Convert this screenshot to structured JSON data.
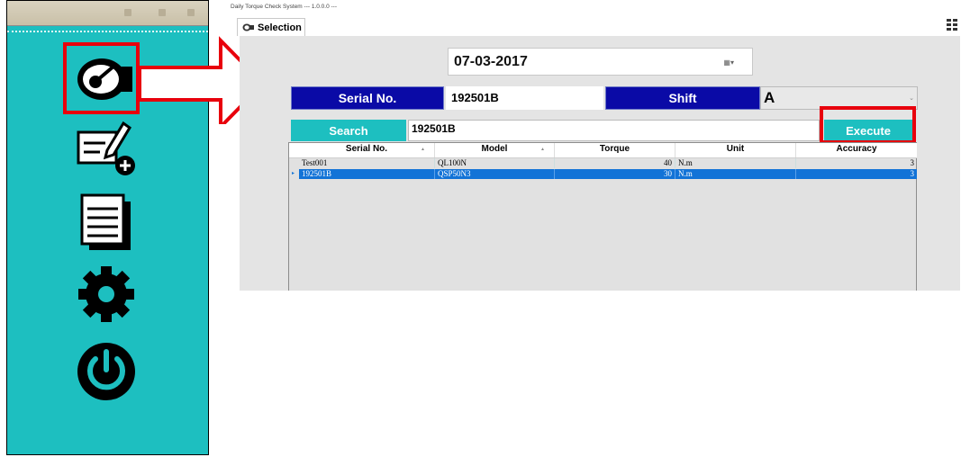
{
  "window": {
    "title": "Daily Torque Check System  ---  1.0.0.0  ---"
  },
  "tab": {
    "label": "Selection"
  },
  "sidebar": {
    "items": [
      {
        "icon": "torque-wrench-icon"
      },
      {
        "icon": "new-document-icon"
      },
      {
        "icon": "list-icon"
      },
      {
        "icon": "settings-icon"
      },
      {
        "icon": "power-icon"
      }
    ]
  },
  "form": {
    "date": "07-03-2017",
    "serial_label": "Serial No.",
    "serial_value": "192501B",
    "shift_label": "Shift",
    "shift_value": "A",
    "search_label": "Search",
    "search_value": "192501B",
    "execute_label": "Execute"
  },
  "table": {
    "columns": [
      "Serial No.",
      "Model",
      "Torque",
      "Unit",
      "Accuracy"
    ],
    "rows": [
      [
        "Test001",
        "QL100N",
        "40",
        "N.m",
        "3"
      ],
      [
        "192501B",
        "QSP50N3",
        "30",
        "N.m",
        "3"
      ]
    ],
    "selected_row": 1
  },
  "colors": {
    "accent": "#1dbfc0",
    "label_blue": "#0a0aa6",
    "highlight": "#e8000c",
    "selection": "#1273d7"
  }
}
